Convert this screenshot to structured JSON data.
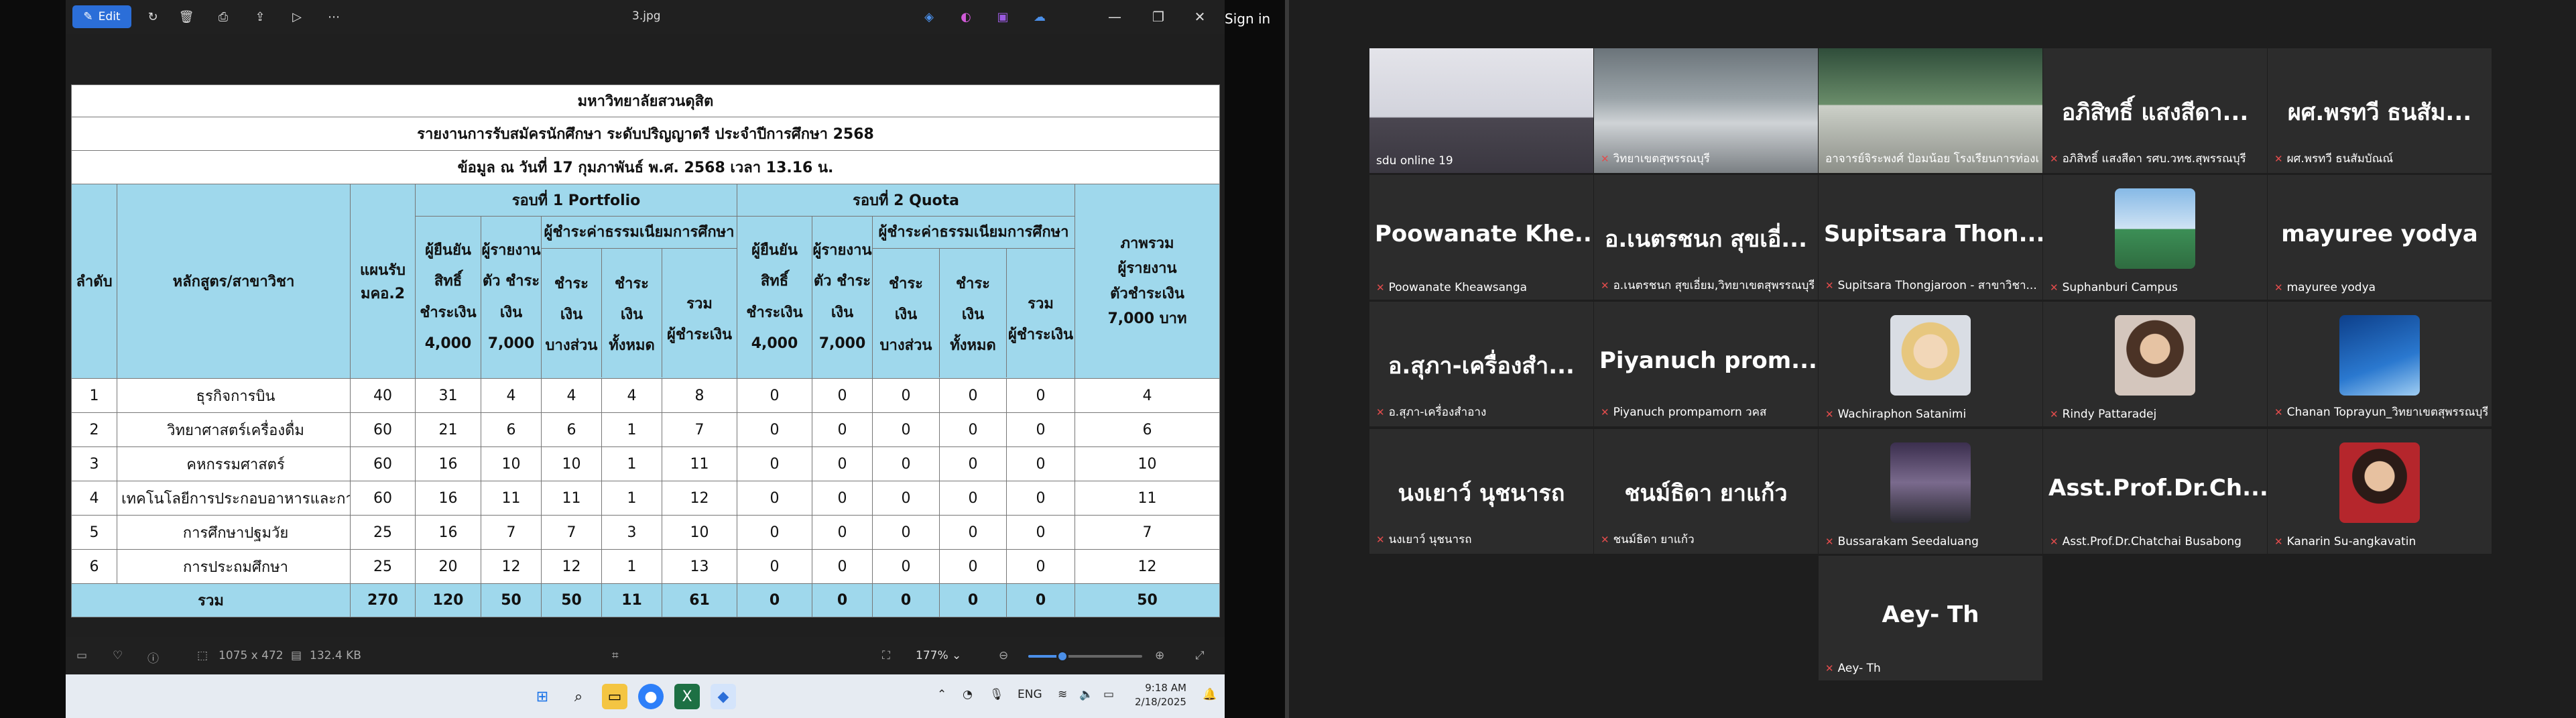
{
  "viewer": {
    "edit_label": "Edit",
    "file_name": "3.jpg",
    "signin_label": "Sign in",
    "doc": {
      "title1": "มหาวิทยาลัยสวนดุสิต",
      "title2": "รายงานการรับสมัครนักศึกษา ระดับปริญญาตรี ประจำปีการศึกษา 2568",
      "title3": "ข้อมูล ณ วันที่ 17 กุมภาพันธ์ พ.ศ. 2568 เวลา 13.16 น.",
      "h_no": "ลำดับ",
      "h_program": "หลักสูตร/สาขาวิชา",
      "h_plan": [
        "แผนรับ",
        "มคอ.2"
      ],
      "round1": "รอบที่ 1 Portfolio",
      "round2": "รอบที่ 2 Quota",
      "total_h": [
        "ภาพรวม",
        "ผู้รายงาน",
        "ตัวชำระเงิน",
        "7,000 บาท"
      ],
      "sub_confirm": [
        "ผู้ยืนยัน",
        "สิทธิ์",
        "ชำระเงิน",
        "4,000"
      ],
      "sub_report": [
        "ผู้รายงาน",
        "ตัว ชำระ",
        "เงิน",
        "7,000"
      ],
      "sub_fee": "ผู้ชำระค่าธรรมเนียมการศึกษา",
      "sub_partial": [
        "ชำระ",
        "เงิน",
        "บางส่วน"
      ],
      "sub_full": [
        "ชำระ",
        "เงิน",
        "ทั้งหมด"
      ],
      "sub_sum": [
        "รวม",
        "ผู้ชำระเงิน"
      ],
      "rows": [
        {
          "no": "1",
          "program": "ธุรกิจการบิน",
          "plan": "40",
          "c1": "31",
          "r1": "4",
          "p1": "4",
          "f1": "4",
          "s1": "8",
          "c2": "0",
          "r2": "0",
          "p2": "0",
          "f2": "0",
          "s2": "0",
          "total": "4"
        },
        {
          "no": "2",
          "program": "วิทยาศาสตร์เครื่องดื่ม",
          "plan": "60",
          "c1": "21",
          "r1": "6",
          "p1": "6",
          "f1": "1",
          "s1": "7",
          "c2": "0",
          "r2": "0",
          "p2": "0",
          "f2": "0",
          "s2": "0",
          "total": "6"
        },
        {
          "no": "3",
          "program": "คหกรรมศาสตร์",
          "plan": "60",
          "c1": "16",
          "r1": "10",
          "p1": "10",
          "f1": "1",
          "s1": "11",
          "c2": "0",
          "r2": "0",
          "p2": "0",
          "f2": "0",
          "s2": "0",
          "total": "10"
        },
        {
          "no": "4",
          "program": "เทคโนโลยีการประกอบอาหารและการบ",
          "plan": "60",
          "c1": "16",
          "r1": "11",
          "p1": "11",
          "f1": "1",
          "s1": "12",
          "c2": "0",
          "r2": "0",
          "p2": "0",
          "f2": "0",
          "s2": "0",
          "total": "11"
        },
        {
          "no": "5",
          "program": "การศึกษาปฐมวัย",
          "plan": "25",
          "c1": "16",
          "r1": "7",
          "p1": "7",
          "f1": "3",
          "s1": "10",
          "c2": "0",
          "r2": "0",
          "p2": "0",
          "f2": "0",
          "s2": "0",
          "total": "7"
        },
        {
          "no": "6",
          "program": "การประถมศึกษา",
          "plan": "25",
          "c1": "20",
          "r1": "12",
          "p1": "12",
          "f1": "1",
          "s1": "13",
          "c2": "0",
          "r2": "0",
          "p2": "0",
          "f2": "0",
          "s2": "0",
          "total": "12"
        }
      ],
      "sum_row": {
        "label": "รวม",
        "plan": "270",
        "c1": "120",
        "r1": "50",
        "p1": "50",
        "f1": "11",
        "s1": "61",
        "c2": "0",
        "r2": "0",
        "p2": "0",
        "f2": "0",
        "s2": "0",
        "total": "50"
      }
    },
    "status": {
      "dimensions": "1075 x 472",
      "size": "132.4 KB",
      "zoom": "177%",
      "zoom_level": 0.3
    },
    "taskbar": {
      "lang": "ENG",
      "time": "9:18 AM",
      "date": "2/18/2025"
    }
  },
  "meeting": {
    "tiles": [
      {
        "name": "",
        "label": "sdu online 19",
        "kind": "video1"
      },
      {
        "name": "",
        "label": "วิทยาเขตสุพรรณบุรี",
        "kind": "video2"
      },
      {
        "name": "",
        "label": "อาจารย์จิระพงศ์ ป้อมน้อย โรงเรียนการท่องเที่...",
        "kind": "video3"
      },
      {
        "name": "อภิสิทธิ์ แสงสีดา...",
        "label": "อภิสิทธิ์ แสงสีดา รศบ.วทช.สุพรรณบุรี"
      },
      {
        "name": "ผศ.พรทวี ธนสัม...",
        "label": "ผศ.พรทวี ธนสัมบัณณ์"
      },
      {
        "name": "Poowanate Khe...",
        "label": "Poowanate Kheawsanga"
      },
      {
        "name": "อ.เนตรชนก สุขเอี่...",
        "label": "อ.เนตรชนก สุขเอี่ยม,วิทยาเขตสุพรรณบุรี"
      },
      {
        "name": "Supitsara Thon...",
        "label": "Supitsara Thongjaroon - สาขาวิชา..."
      },
      {
        "name": "",
        "label": "Suphanburi Campus",
        "kind": "thumb-building"
      },
      {
        "name": "mayuree yodya",
        "label": "mayuree yodya"
      },
      {
        "name": "อ.สุภา-เครื่องสำ...",
        "label": "อ.สุภา-เครื่องสำอาง"
      },
      {
        "name": "Piyanuch prom...",
        "label": "Piyanuch prompamorn วคส"
      },
      {
        "name": "",
        "label": "Wachiraphon Satanimi",
        "kind": "thumb-person-blonde"
      },
      {
        "name": "",
        "label": "Rindy Pattaradej",
        "kind": "thumb-person"
      },
      {
        "name": "",
        "label": "Chanan Toprayun_วิทยาเขตสุพรรณบุรี",
        "kind": "thumb-blue"
      },
      {
        "name": "นงเยาว์ นุชนารถ",
        "label": "นงเยาว์ นุชนารถ"
      },
      {
        "name": "ชนม์ธิดา ยาแก้ว",
        "label": "ชนม์ธิดา ยาแก้ว"
      },
      {
        "name": "",
        "label": "Bussarakam Seedaluang",
        "kind": "thumb-person-dark"
      },
      {
        "name": "Asst.Prof.Dr.Ch...",
        "label": "Asst.Prof.Dr.Chatchai Busabong"
      },
      {
        "name": "",
        "label": "Kanarin Su-angkavatin",
        "kind": "thumb-person-red"
      },
      {
        "name": "Aey- Th",
        "label": "Aey- Th"
      }
    ]
  }
}
